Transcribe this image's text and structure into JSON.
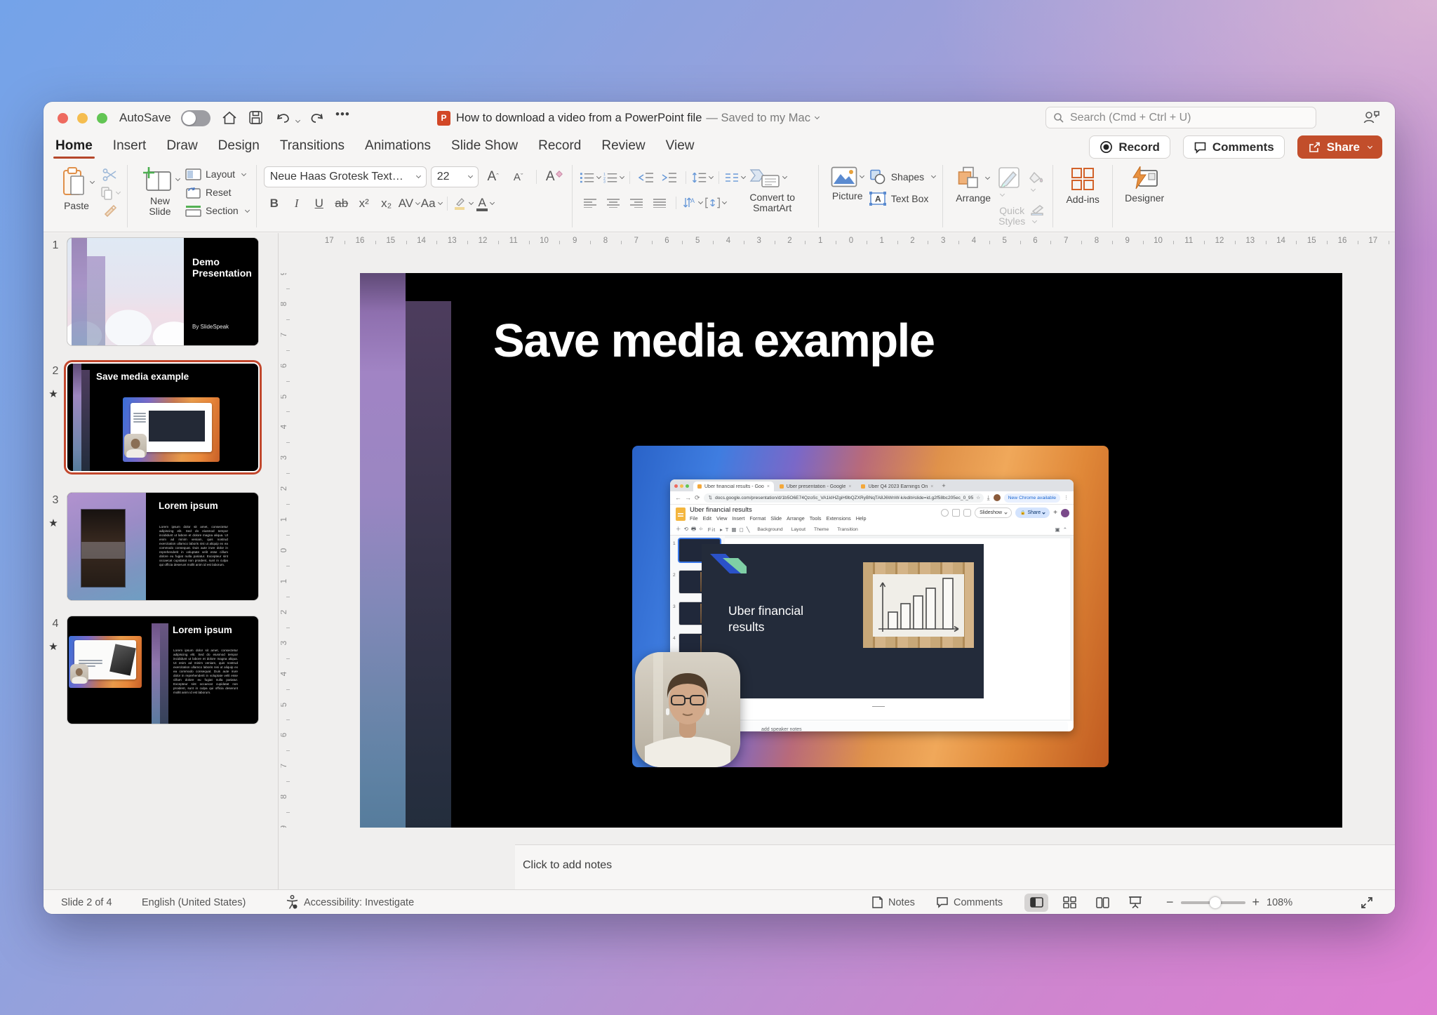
{
  "colors": {
    "accent": "#C2472D",
    "share_button": "#C24E2B",
    "tab_underline": "#B5472A"
  },
  "titlebar": {
    "autosave": "AutoSave",
    "doc_badge": "P",
    "title": "How to download a video from a PowerPoint file",
    "title_suffix": "— Saved to my Mac",
    "more": "•••"
  },
  "search": {
    "placeholder": "Search (Cmd + Ctrl + U)"
  },
  "tabs": {
    "active": "Home",
    "items": [
      "Home",
      "Insert",
      "Draw",
      "Design",
      "Transitions",
      "Animations",
      "Slide Show",
      "Record",
      "Review",
      "View"
    ]
  },
  "actions": {
    "record": "Record",
    "comments": "Comments",
    "share": "Share"
  },
  "ribbon": {
    "paste": "Paste",
    "new_slide": "New Slide",
    "layout": "Layout",
    "reset": "Reset",
    "section": "Section",
    "font_name": "Neue Haas Grotesk Text…",
    "font_size": "22",
    "bold": "B",
    "italic": "I",
    "underline": "U",
    "strike": "ab",
    "superscript": "x²",
    "subscript": "x₂",
    "char_spacing": "AV",
    "change_case": "Aa",
    "font_color": "A",
    "clear_format": "A",
    "convert": "Convert to SmartArt",
    "picture": "Picture",
    "shapes": "Shapes",
    "text_box": "Text Box",
    "text_box_glyph": "A",
    "arrange": "Arrange",
    "quick_styles": "Quick Styles",
    "add_ins": "Add-ins",
    "designer": "Designer"
  },
  "panel": {
    "slides": [
      {
        "num": "1",
        "star": "",
        "title1": "Demo",
        "title2": "Presentation",
        "byline": "By SlideSpeak"
      },
      {
        "num": "2",
        "star": "★",
        "title": "Save media example",
        "selected": true
      },
      {
        "num": "3",
        "star": "★",
        "title": "Lorem ipsum",
        "body": "Lorem ipsum dolor sit amet, consectetur adipiscing elit. Sed do eiusmod tempor incididunt ut labore et dolore magna aliqua. Ut enim ad minim veniam, quis nostrud exercitation ullamco laboris nisi ut aliquip ex ea commodo consequat. Duis aute irure dolor in reprehenderit in voluptate velit esse cillum dolore eu fugiat nulla pariatur. Excepteur sint occaecat cupidatat non proident, sunt in culpa qui officia deserunt mollit anim id est laborum."
      },
      {
        "num": "4",
        "star": "★",
        "title": "Lorem ipsum",
        "body": "Lorem ipsum dolor sit amet, consectetur adipiscing elit. Sed do eiusmod tempor incididunt ut labore et dolore magna aliqua. Ut enim ad minim veniam, quis nostrud exercitation ullamco laboris nisi ut aliquip ex ea commodo consequat. Duis aute irure dolor in reprehenderit in voluptate velit esse cillum dolore eu fugiat nulla pariatur. Excepteur sint occaecat cupidatat non proident, sunt in culpa qui officia deserunt mollit anim id est laborum."
      }
    ]
  },
  "slide": {
    "title": "Save media example"
  },
  "shot": {
    "browser_tabs": [
      "Uber financial results - Goo",
      "Uber presentation - Google",
      "Uber Q4 2023 Earnings On"
    ],
    "new_tab": "+",
    "url": "docs.google.com/presentation/d/1b5O6E74QzoSc_VA1kIHZgiH9bQZXRyBNqTA8J6WnW-k/edit#slide=id.g2f58bc205ec_0_95",
    "new_chrome": "New Chrome available",
    "doc_title": "Uber financial results",
    "menus": [
      "File",
      "Edit",
      "View",
      "Insert",
      "Format",
      "Slide",
      "Arrange",
      "Tools",
      "Extensions",
      "Help"
    ],
    "slideshow": "Slideshow",
    "share": "Share",
    "toolbar": [
      "Background",
      "Layout",
      "Theme",
      "Transition"
    ],
    "fit": "Fit",
    "filmstrip": [
      "1",
      "2",
      "3",
      "4"
    ],
    "slide_title": "Uber financial results",
    "speaker_notes": "add speaker notes"
  },
  "notes": {
    "placeholder": "Click to add notes"
  },
  "status": {
    "slide": "Slide 2 of 4",
    "language": "English (United States)",
    "accessibility": "Accessibility: Investigate",
    "notes": "Notes",
    "comments": "Comments",
    "minus": "−",
    "plus": "+",
    "zoom": "108%"
  },
  "rulers": {
    "h_count": 16,
    "h_spacing": 43.75,
    "h_origin": 787,
    "v_count": 9,
    "v_spacing": 43.9,
    "v_origin": 395
  }
}
